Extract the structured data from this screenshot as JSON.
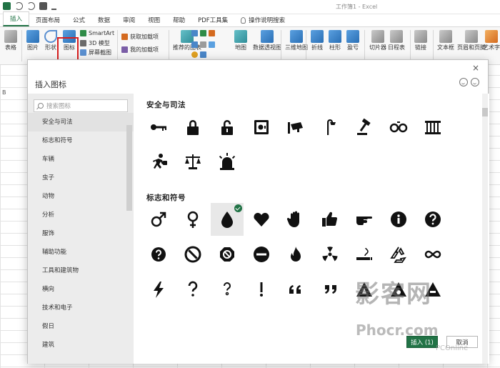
{
  "window": {
    "title": "工作簿1 - Excel"
  },
  "ribbon_tabs": [
    "插入",
    "页面布局",
    "公式",
    "数据",
    "审阅",
    "视图",
    "帮助",
    "PDF工具集"
  ],
  "tell_me": "操作说明搜索",
  "ribbon": {
    "table": "表格",
    "pictures": "图片",
    "shapes": "形状",
    "icons": "图标",
    "smartart": "SmartArt",
    "model3d": "3D 模型",
    "screenshot": "屏幕截图",
    "get_addins": "获取加载项",
    "my_addins": "我的加载项",
    "recommended_charts": "推荐的图表",
    "maps": "地图",
    "pivotchart": "数据透视图",
    "map3d": "三维地图",
    "line": "折线",
    "column": "柱形",
    "winloss": "盈亏",
    "slicer": "切片器",
    "timeline": "日程表",
    "link": "链接",
    "textbox": "文本框",
    "header_footer": "页眉和页脚",
    "wordart": "艺术字"
  },
  "sheet": {
    "column_b": "B"
  },
  "dialog": {
    "title": "插入图标",
    "close": "×",
    "search_placeholder": "搜索图标",
    "categories": [
      "安全与司法",
      "标志和符号",
      "车辆",
      "虫子",
      "动物",
      "分析",
      "服饰",
      "辅助功能",
      "工具和建筑物",
      "横向",
      "技术和电子",
      "假日",
      "建筑"
    ],
    "active_category": 0,
    "sections": [
      {
        "title": "安全与司法",
        "icons": [
          "key-icon",
          "lock-icon",
          "unlock-icon",
          "safe-icon",
          "cctv-camera-icon",
          "street-lamp-icon",
          "gavel-icon",
          "handcuffs-icon",
          "jail-bars-icon",
          "running-thief-icon",
          "justice-scales-icon",
          "siren-icon"
        ]
      },
      {
        "title": "标志和符号",
        "icons": [
          "male-symbol-icon",
          "female-symbol-icon",
          "drop-icon",
          "heart-icon",
          "hand-stop-icon",
          "thumbs-up-icon",
          "pointing-hand-icon",
          "info-icon",
          "question-circle-icon",
          "question-circle-small-icon",
          "no-entry-icon",
          "prohibited-icon",
          "minus-circle-icon",
          "flame-icon",
          "radiation-icon",
          "smoking-icon",
          "recycle-icon",
          "infinity-icon",
          "lightning-icon",
          "question-mark-icon",
          "question-hook-icon",
          "exclamation-icon",
          "open-quote-icon",
          "close-quote-icon",
          "warning-a-icon",
          "warning-b-icon",
          "warning-c-icon"
        ]
      }
    ],
    "selected_icon": "drop-icon",
    "insert_button": "插入 (1)",
    "cancel_button": "取消"
  },
  "watermark": {
    "line1": "影客网",
    "line2": "Phocr.com",
    "line3": "PCOnline"
  },
  "colors": {
    "accent": "#217346",
    "highlight_box": "#d81e1e"
  }
}
